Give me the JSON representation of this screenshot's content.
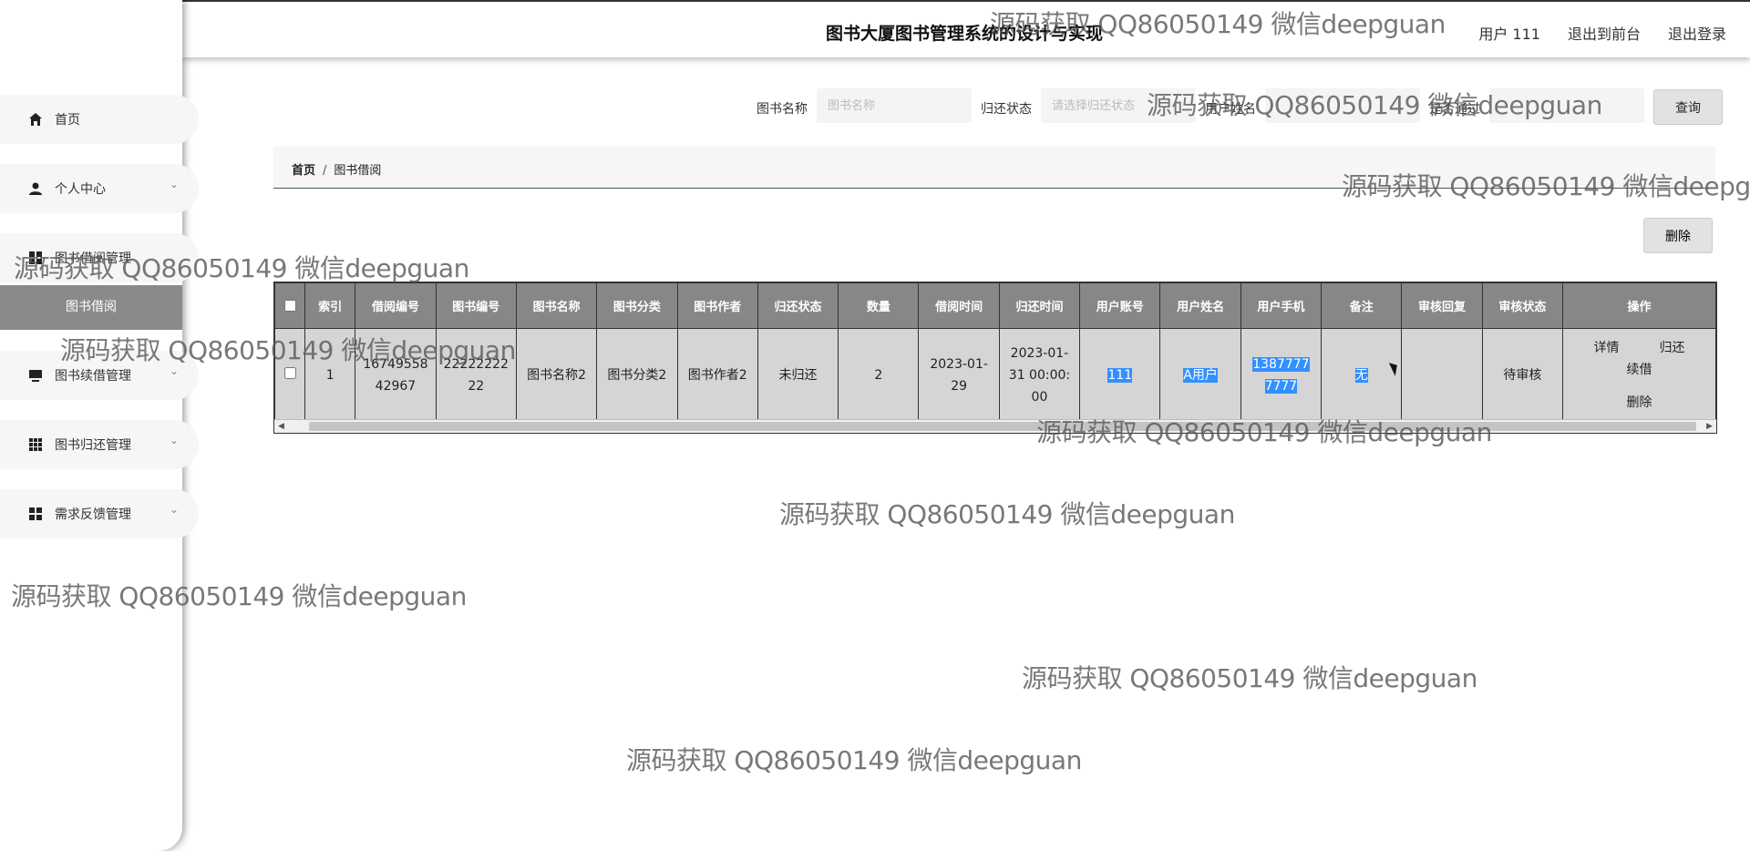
{
  "header": {
    "title": "图书大厦图书管理系统的设计与实现",
    "user_label": "用户 111",
    "back_to_front": "退出到前台",
    "logout": "退出登录"
  },
  "sidebar": {
    "items": [
      {
        "label": "首页",
        "icon": "home-icon"
      },
      {
        "label": "个人中心",
        "icon": "user-icon"
      },
      {
        "label": "图书借阅管理",
        "icon": "grid-icon"
      },
      {
        "label": "图书续借管理",
        "icon": "monitor-icon"
      },
      {
        "label": "图书归还管理",
        "icon": "grid-icon"
      },
      {
        "label": "需求反馈管理",
        "icon": "apps-icon"
      }
    ],
    "active_sub": "图书借阅"
  },
  "search": {
    "book_name_label": "图书名称",
    "book_name_placeholder": "图书名称",
    "return_status_label": "归还状态",
    "return_status_placeholder": "请选择归还状态",
    "user_name_label": "用户姓名",
    "approved_label": "是否通过",
    "query_button": "查询"
  },
  "breadcrumb": {
    "home": "首页",
    "sep": "/",
    "current": "图书借阅"
  },
  "toolbar": {
    "delete_button": "删除"
  },
  "table": {
    "headers": [
      "索引",
      "借阅编号",
      "图书编号",
      "图书名称",
      "图书分类",
      "图书作者",
      "归还状态",
      "数量",
      "借阅时间",
      "归还时间",
      "用户账号",
      "用户姓名",
      "用户手机",
      "备注",
      "审核回复",
      "审核状态",
      "操作"
    ],
    "rows": [
      {
        "index": "1",
        "borrow_no": "1674955842967",
        "book_no": "2222222222",
        "book_name": "图书名称2",
        "category": "图书分类2",
        "author": "图书作者2",
        "return_status": "未归还",
        "quantity": "2",
        "borrow_time": "2023-01-29",
        "return_time": "2023-01-31 00:00:00",
        "account": "111",
        "user_name": "A用户",
        "phone": "13877777777",
        "remark": "无",
        "review_reply": "",
        "review_status": "待审核",
        "ops": {
          "detail": "详情",
          "return": "归还",
          "renew": "续借",
          "delete": "删除"
        }
      }
    ]
  },
  "watermark": "源码获取 QQ86050149 微信deepguan"
}
